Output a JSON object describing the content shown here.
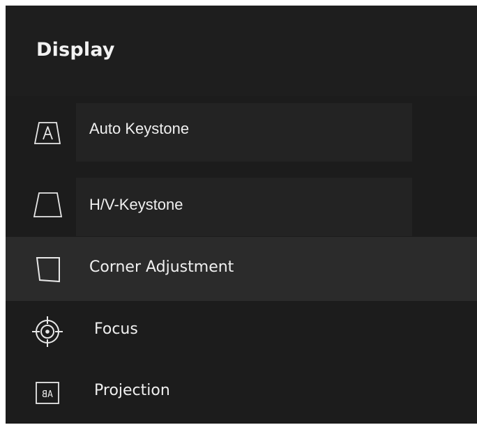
{
  "header": {
    "title": "Display"
  },
  "menu": {
    "items": [
      {
        "label": "Auto Keystone",
        "icon": "auto-keystone-icon"
      },
      {
        "label": "H/V-Keystone",
        "icon": "hv-keystone-icon"
      },
      {
        "label": "Corner Adjustment",
        "icon": "corner-adjustment-icon",
        "selected": true
      },
      {
        "label": "Focus",
        "icon": "focus-icon"
      },
      {
        "label": "Projection",
        "icon": "projection-icon"
      }
    ]
  },
  "colors": {
    "background": "#1b1b1b",
    "selected_row": "#2b2b2b",
    "label_box": "#232323",
    "text": "#f0f0f0"
  }
}
